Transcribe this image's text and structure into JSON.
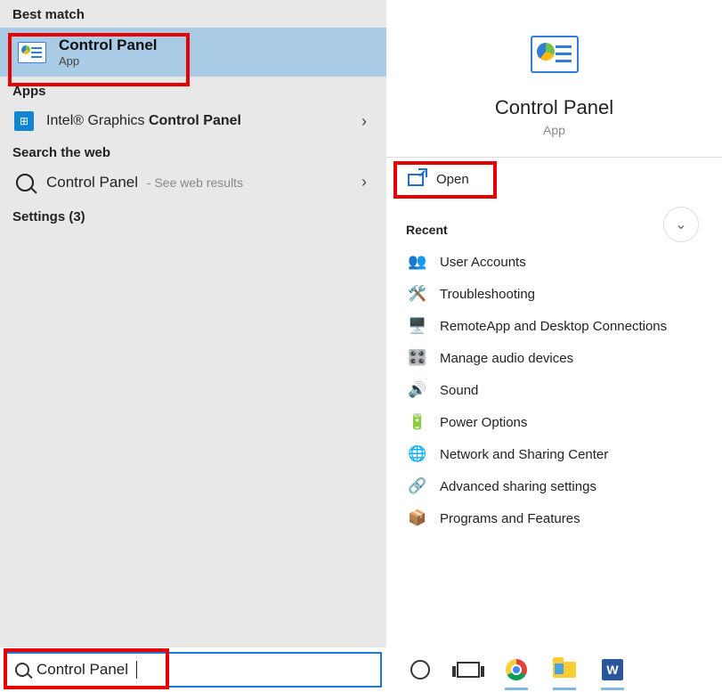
{
  "left": {
    "bestMatchLabel": "Best match",
    "bestMatch": {
      "title": "Control Panel",
      "subtitle": "App"
    },
    "appsLabel": "Apps",
    "appsItem": {
      "prefix": "Intel® Graphics ",
      "bold": "Control Panel"
    },
    "webLabel": "Search the web",
    "webItem": {
      "title": "Control Panel",
      "hint": " - See web results"
    },
    "settingsLabel": "Settings (3)"
  },
  "right": {
    "title": "Control Panel",
    "subtitle": "App",
    "openLabel": "Open",
    "recentLabel": "Recent",
    "recent": [
      {
        "icon": "👥",
        "label": "User Accounts"
      },
      {
        "icon": "🛠️",
        "label": "Troubleshooting"
      },
      {
        "icon": "🖥️",
        "label": "RemoteApp and Desktop Connections"
      },
      {
        "icon": "🎛️",
        "label": "Manage audio devices"
      },
      {
        "icon": "🔊",
        "label": "Sound"
      },
      {
        "icon": "🔋",
        "label": "Power Options"
      },
      {
        "icon": "🌐",
        "label": "Network and Sharing Center"
      },
      {
        "icon": "🔗",
        "label": "Advanced sharing settings"
      },
      {
        "icon": "📦",
        "label": "Programs and Features"
      }
    ]
  },
  "taskbar": {
    "searchValue": "Control Panel",
    "wordLabel": "W"
  }
}
